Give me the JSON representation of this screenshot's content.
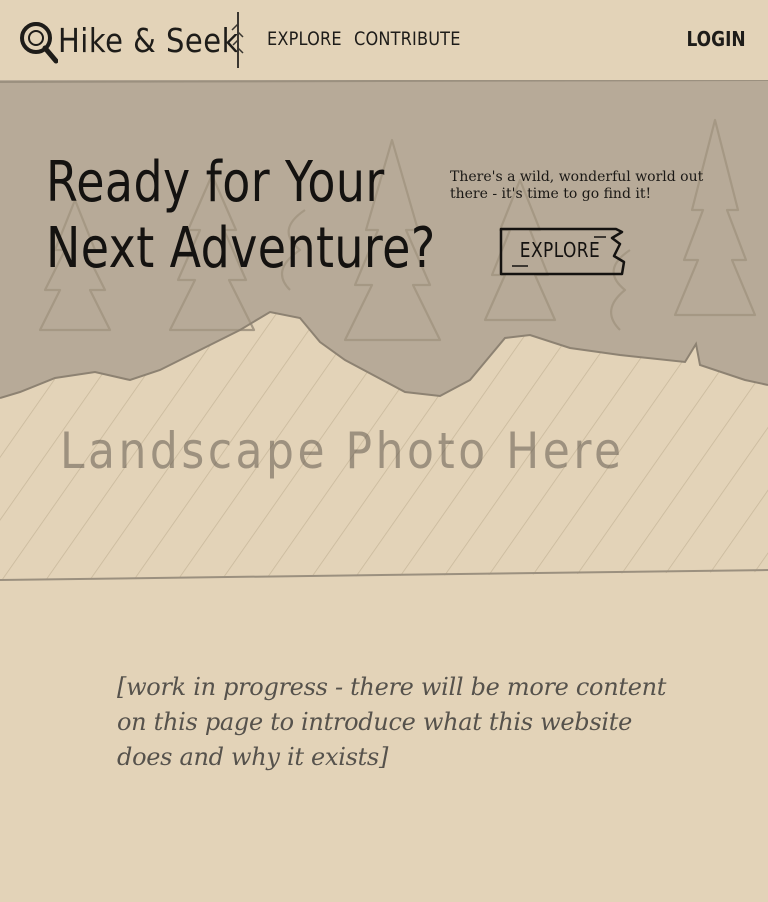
{
  "brand": {
    "name": "Hike & Seek",
    "icon": "magnifying-glass-icon"
  },
  "nav": {
    "explore": "Explore",
    "contribute": "Contribute",
    "login": "Login",
    "divider_icon": "feather-divider-icon"
  },
  "hero": {
    "title_line1": "Ready for Your",
    "title_line2": "Next Adventure?",
    "tagline": "There's a wild, wonderful world out there - it's time to go find it!",
    "cta_label": "Explore",
    "photo_placeholder": "Landscape Photo Here"
  },
  "intro": {
    "text": "[work in progress - there will be more content on this page to introduce what this website does and why it exists]"
  },
  "colors": {
    "background": "#e3d3b8",
    "hero_trees": "#b7aa98",
    "ink": "#1c1a17",
    "muted_text": "#56524c"
  }
}
